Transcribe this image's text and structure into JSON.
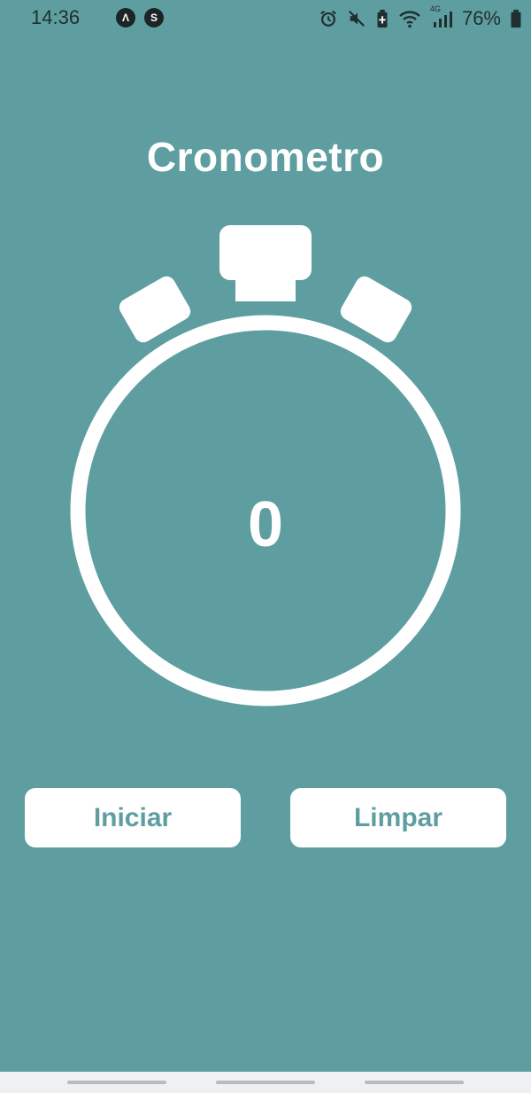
{
  "status_bar": {
    "time": "14:36",
    "battery_percent": "76%",
    "network_label": "4G",
    "app_badges": [
      {
        "icon": "a-logo-icon",
        "glyph": "Λ"
      },
      {
        "icon": "shazam-icon",
        "glyph": "S"
      }
    ],
    "icons": [
      "alarm-icon",
      "mute-icon",
      "battery-saver-icon",
      "wifi-icon",
      "signal-icon",
      "battery-icon"
    ]
  },
  "app": {
    "title": "Cronometro",
    "counter_value": "0"
  },
  "buttons": {
    "start_label": "Iniciar",
    "clear_label": "Limpar"
  },
  "colors": {
    "background": "#5f9ea0",
    "foreground": "#ffffff",
    "button_text": "#5f9ea0",
    "navigation_bar": "#eff0f3"
  }
}
